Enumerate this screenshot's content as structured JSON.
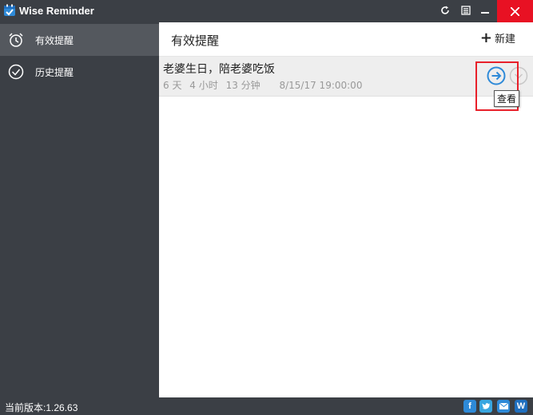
{
  "window": {
    "title": "Wise Reminder",
    "close_color": "#e81123"
  },
  "sidebar": {
    "items": [
      {
        "label": "有效提醒",
        "icon": "alarm-clock-icon",
        "active": true
      },
      {
        "label": "历史提醒",
        "icon": "check-circle-icon",
        "active": false
      }
    ]
  },
  "main": {
    "title": "有效提醒",
    "new_label": "新建",
    "reminders": [
      {
        "title": "老婆生日，陪老婆吃饭",
        "days": "6 天",
        "hours": "4 小时",
        "minutes": "13 分钟",
        "datetime": "8/15/17 19:00:00"
      }
    ]
  },
  "tooltip": {
    "text": "查看"
  },
  "footer": {
    "version": "当前版本:1.26.63",
    "social": [
      "facebook-icon",
      "twitter-icon",
      "mail-icon",
      "website-icon"
    ]
  },
  "colors": {
    "sidebar_bg": "#3b3f45",
    "active_item_bg": "#54585e",
    "accent": "#2e8ad8",
    "highlight_border": "#e8202a"
  }
}
